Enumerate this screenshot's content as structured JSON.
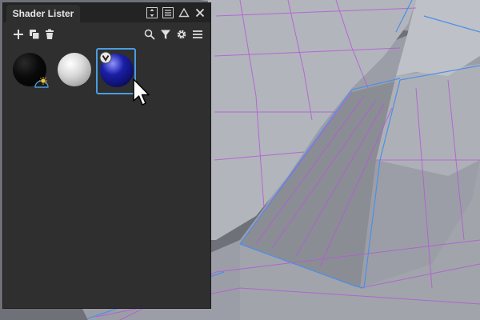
{
  "panel": {
    "title": "Shader Lister",
    "titlebar_icons": [
      "expand-vertical-icon",
      "list-menu-icon",
      "collapse-up-icon",
      "close-icon"
    ],
    "toolbar": {
      "left": [
        "add-icon",
        "duplicate-icon",
        "trash-icon"
      ],
      "right": [
        "search-icon",
        "filter-icon",
        "gear-icon",
        "hamburger-menu-icon"
      ]
    },
    "shaders": [
      {
        "name": "black-shader-swatch",
        "color": "#0a0a0a",
        "badge": "sun-light-badge-icon",
        "selected": false
      },
      {
        "name": "white-shader-swatch",
        "color": "#d9d9d9",
        "badge": null,
        "selected": false
      },
      {
        "name": "blue-shader-swatch",
        "color": "#1b1fa6",
        "badge": "checkmark-badge-icon",
        "selected": true
      }
    ]
  },
  "colors": {
    "panel_bg": "#2f2f2f",
    "titlebar_bg": "#232323",
    "selection": "#4a9ee0",
    "viewport_surface": "#a9abb4",
    "curve_purple": "#b25bd6",
    "curve_blue": "#4c8fe6"
  }
}
